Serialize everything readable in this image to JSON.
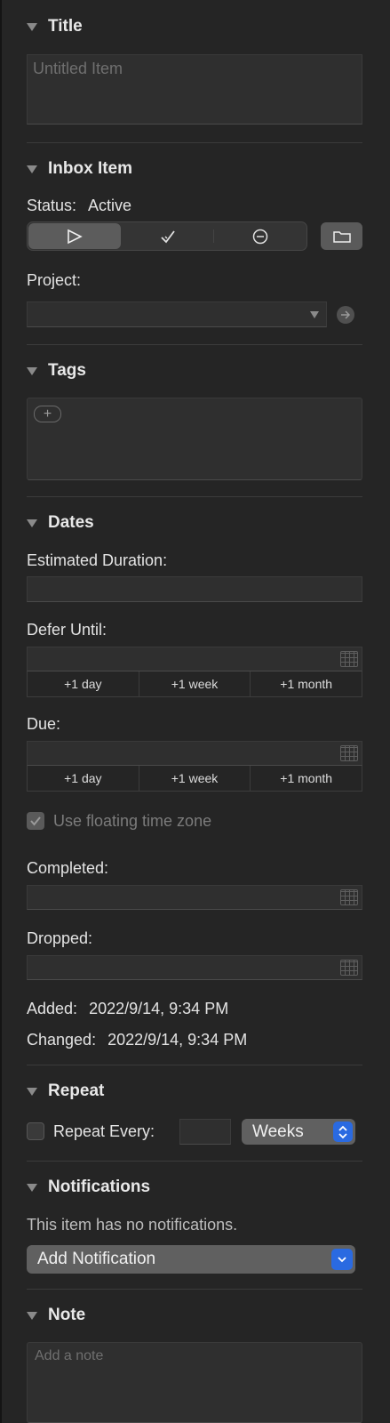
{
  "sections": {
    "title": "Title",
    "inbox": "Inbox Item",
    "tags": "Tags",
    "dates": "Dates",
    "repeat": "Repeat",
    "notifications": "Notifications",
    "note": "Note"
  },
  "title_field": {
    "placeholder": "Untitled Item"
  },
  "status": {
    "label": "Status:",
    "value": "Active"
  },
  "project": {
    "label": "Project:"
  },
  "dates": {
    "estimated_duration": "Estimated Duration:",
    "defer_until": "Defer Until:",
    "due": "Due:",
    "quick_buttons": [
      "+1 day",
      "+1 week",
      "+1 month"
    ],
    "floating_tz": "Use floating time zone",
    "completed": "Completed:",
    "dropped": "Dropped:",
    "added_label": "Added:",
    "added_value": "2022/9/14, 9:34 PM",
    "changed_label": "Changed:",
    "changed_value": "2022/9/14, 9:34 PM"
  },
  "repeat": {
    "label": "Repeat Every:",
    "unit": "Weeks"
  },
  "notifications": {
    "empty_text": "This item has no notifications.",
    "add_label": "Add Notification"
  },
  "note": {
    "placeholder": "Add a note"
  },
  "icons": {
    "section_toggle": "disclosure-triangle-icon",
    "status_active": "play-outline-icon",
    "status_complete": "checkmark-icon",
    "status_dropped": "minus-circle-icon",
    "folder": "folder-icon",
    "jump": "arrow-circle-icon",
    "add_tag": "plus-icon",
    "calendar": "calendar-icon",
    "popup_arrows": "chevron-updown-icon"
  },
  "colors": {
    "accent": "#2a6ae1",
    "background": "#252525"
  }
}
